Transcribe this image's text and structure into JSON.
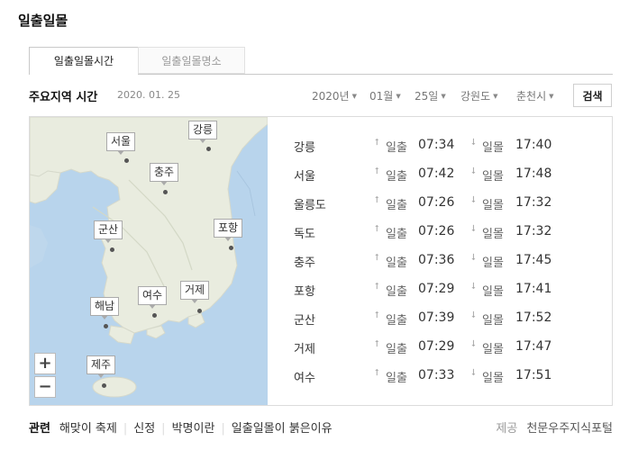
{
  "title": "일출일몰",
  "tabs": [
    {
      "label": "일출일몰시간",
      "active": true
    },
    {
      "label": "일출일몰명소",
      "active": false
    }
  ],
  "section": {
    "title": "주요지역 시간",
    "date": "2020. 01. 25"
  },
  "selectors": {
    "year": "2020년",
    "month": "01월",
    "day": "25일",
    "province": "강원도",
    "city": "춘천시"
  },
  "search_label": "검색",
  "map": {
    "labels": [
      "강릉",
      "서울",
      "충주",
      "군산",
      "포항",
      "여수",
      "거제",
      "해남",
      "제주"
    ],
    "zoom_in": "+",
    "zoom_out": "−"
  },
  "sunrise_label": "일출",
  "sunset_label": "일몰",
  "rows": [
    {
      "city": "강릉",
      "sunrise": "07:34",
      "sunset": "17:40"
    },
    {
      "city": "서울",
      "sunrise": "07:42",
      "sunset": "17:48"
    },
    {
      "city": "울릉도",
      "sunrise": "07:26",
      "sunset": "17:32"
    },
    {
      "city": "독도",
      "sunrise": "07:26",
      "sunset": "17:32"
    },
    {
      "city": "충주",
      "sunrise": "07:36",
      "sunset": "17:45"
    },
    {
      "city": "포항",
      "sunrise": "07:29",
      "sunset": "17:41"
    },
    {
      "city": "군산",
      "sunrise": "07:39",
      "sunset": "17:52"
    },
    {
      "city": "거제",
      "sunrise": "07:29",
      "sunset": "17:47"
    },
    {
      "city": "여수",
      "sunrise": "07:33",
      "sunset": "17:51"
    }
  ],
  "footer": {
    "label": "관련",
    "links": [
      "해맞이 축제",
      "신정",
      "박명이란",
      "일출일몰이 붉은이유"
    ],
    "provider_label": "제공",
    "provider_name": "천문우주지식포털"
  },
  "colors": {
    "sea": "#b8d4ec",
    "land": "#e9ecdf"
  }
}
